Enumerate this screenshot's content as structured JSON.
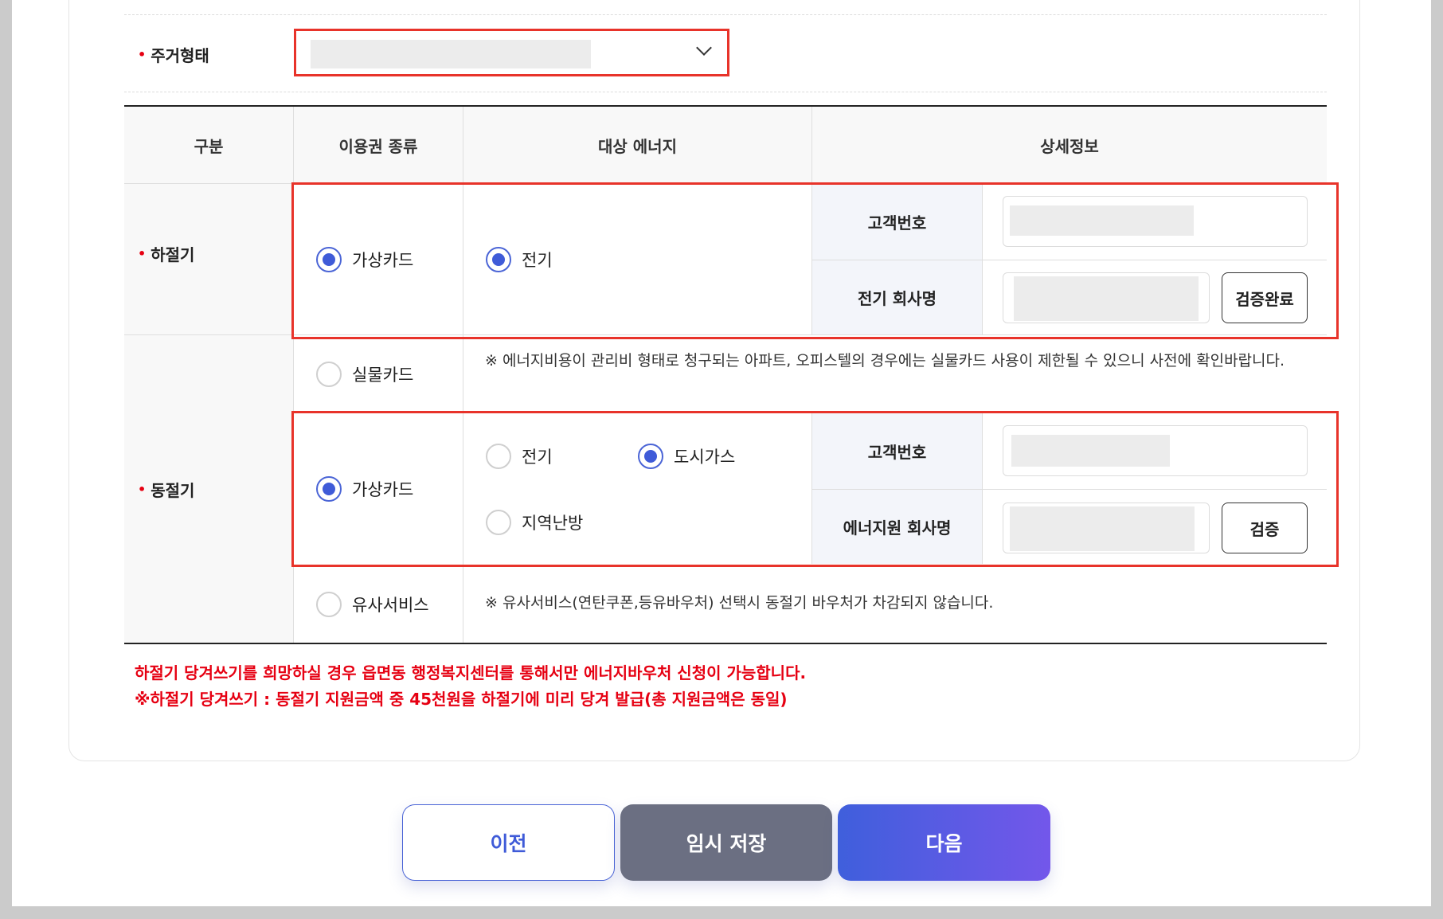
{
  "housing": {
    "label": "주거형태",
    "select_value": ""
  },
  "table": {
    "headers": [
      "구분",
      "이용권 종류",
      "대상 에너지",
      "상세정보"
    ],
    "summer": {
      "label": "하절기",
      "voucher": {
        "label": "가상카드",
        "checked": true
      },
      "energy": [
        {
          "label": "전기",
          "checked": true
        }
      ],
      "customer_no_label": "고객번호",
      "company_label": "전기 회사명",
      "verify_label": "검증완료"
    },
    "winter": {
      "label": "동절기",
      "physical_card": {
        "label": "실물카드",
        "checked": false
      },
      "physical_note": "※ 에너지비용이 관리비 형태로 청구되는 아파트, 오피스텔의 경우에는 실물카드 사용이 제한될 수 있으니 사전에 확인바랍니다.",
      "virtual_card": {
        "label": "가상카드",
        "checked": true
      },
      "energy": [
        {
          "label": "전기",
          "checked": false
        },
        {
          "label": "도시가스",
          "checked": true
        },
        {
          "label": "지역난방",
          "checked": false
        }
      ],
      "customer_no_label": "고객번호",
      "company_label": "에너지원 회사명",
      "verify_label": "검증",
      "similar_service": {
        "label": "유사서비스",
        "checked": false
      },
      "similar_note": "※ 유사서비스(연탄쿠폰,등유바우처) 선택시 동절기 바우처가 차감되지 않습니다."
    }
  },
  "warnings": [
    "하절기 당겨쓰기를 희망하실 경우 읍면동 행정복지센터를 통해서만 에너지바우처 신청이 가능합니다.",
    "※하절기 당겨쓰기 : 동절기 지원금액 중 45천원을 하절기에 미리 당겨 발급(총 지원금액은 동일)"
  ],
  "buttons": {
    "prev": "이전",
    "save": "임시 저장",
    "next": "다음"
  },
  "colors": {
    "accent": "#3f5bd8",
    "highlight_border": "#e8332a",
    "warning_text": "#e60012",
    "save_button": "#6b6f82"
  }
}
